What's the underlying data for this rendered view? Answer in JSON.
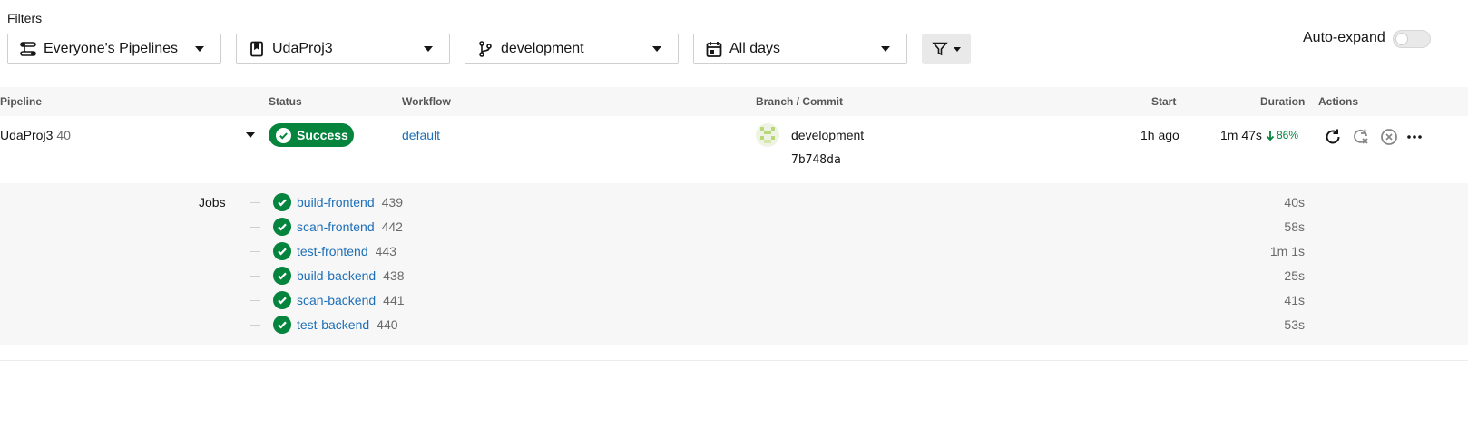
{
  "filters": {
    "label": "Filters",
    "dropdowns": [
      {
        "icon": "pipelines-icon",
        "value": "Everyone's Pipelines"
      },
      {
        "icon": "project-icon",
        "value": "UdaProj3"
      },
      {
        "icon": "branch-icon",
        "value": "development"
      },
      {
        "icon": "calendar-icon",
        "value": "All days"
      }
    ],
    "filter_button_icon": "funnel-icon"
  },
  "auto_expand": {
    "label": "Auto-expand",
    "enabled": false
  },
  "table": {
    "headers": {
      "pipeline": "Pipeline",
      "status": "Status",
      "workflow": "Workflow",
      "branch_commit": "Branch / Commit",
      "start": "Start",
      "duration": "Duration",
      "actions": "Actions"
    }
  },
  "pipeline": {
    "name": "UdaProj3",
    "number": "40",
    "status": "Success",
    "workflow": "default",
    "branch": "development",
    "commit": "7b748da",
    "start": "1h ago",
    "duration": "1m 47s",
    "duration_change": "86%",
    "actions": [
      "rerun-icon",
      "rerun-failed-icon",
      "cancel-icon",
      "more-icon"
    ]
  },
  "jobs": {
    "label": "Jobs",
    "items": [
      {
        "name": "build-frontend",
        "number": "439",
        "duration": "40s"
      },
      {
        "name": "scan-frontend",
        "number": "442",
        "duration": "58s"
      },
      {
        "name": "test-frontend",
        "number": "443",
        "duration": "1m 1s"
      },
      {
        "name": "build-backend",
        "number": "438",
        "duration": "25s"
      },
      {
        "name": "scan-backend",
        "number": "441",
        "duration": "41s"
      },
      {
        "name": "test-backend",
        "number": "440",
        "duration": "53s"
      }
    ]
  },
  "colors": {
    "success": "#04843d",
    "link": "#1d6fb8",
    "header_bg": "#f7f7f7"
  }
}
